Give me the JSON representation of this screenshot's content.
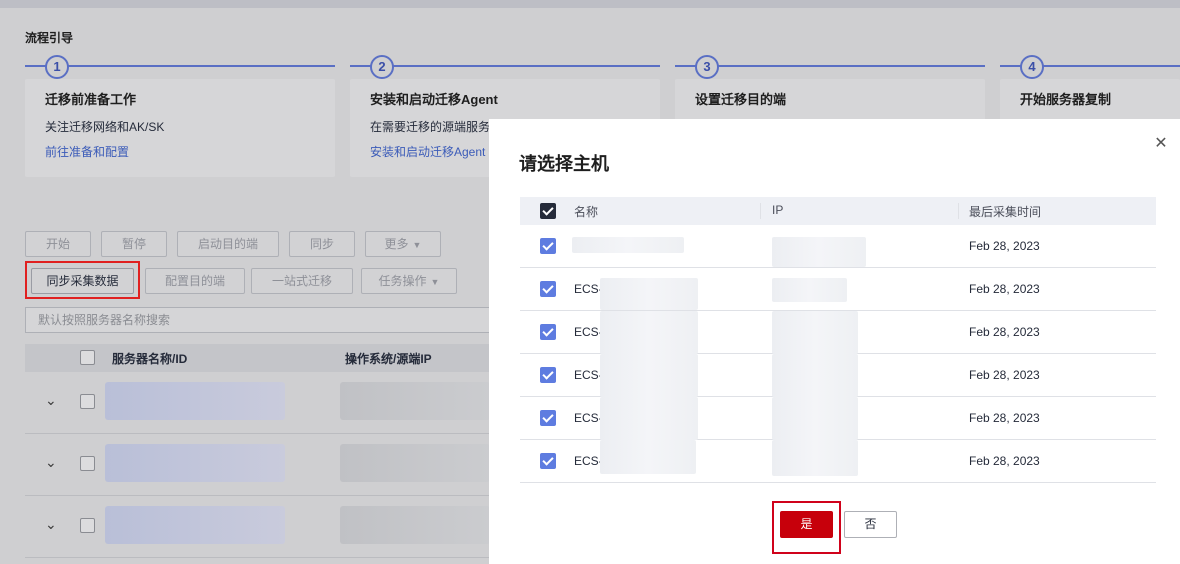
{
  "guide": {
    "title": "流程引导",
    "steps": [
      {
        "num": "1",
        "title": "迁移前准备工作",
        "desc": "关注迁移网络和AK/SK",
        "link": "前往准备和配置"
      },
      {
        "num": "2",
        "title": "安装和启动迁移Agent",
        "desc": "在需要迁移的源端服务器",
        "link": "安装和启动迁移Agent"
      },
      {
        "num": "3",
        "title": "设置迁移目的端",
        "desc": "",
        "link": ""
      },
      {
        "num": "4",
        "title": "开始服务器复制",
        "desc": "",
        "link": ""
      }
    ]
  },
  "toolbar": {
    "start": "开始",
    "pause": "暂停",
    "start_target": "启动目的端",
    "sync": "同步",
    "more": "更多",
    "sync_collect": "同步采集数据",
    "config_target": "配置目的端",
    "one_stop": "一站式迁移",
    "task_ops": "任务操作"
  },
  "search": {
    "placeholder": "默认按照服务器名称搜索"
  },
  "server_table": {
    "headers": [
      "服务器名称/ID",
      "操作系统/源端IP"
    ]
  },
  "dialog": {
    "title": "请选择主机",
    "headers": {
      "name": "名称",
      "ip": "IP",
      "time": "最后采集时间"
    },
    "rows": [
      {
        "name": "",
        "time": "Feb 28, 2023"
      },
      {
        "name": "ECS-",
        "time": "Feb 28, 2023"
      },
      {
        "name": "ECS-",
        "time": "Feb 28, 2023"
      },
      {
        "name": "ECS-",
        "time": "Feb 28, 2023"
      },
      {
        "name": "ECS-",
        "time": "Feb 28, 2023"
      },
      {
        "name": "ECS-",
        "time": "Feb 28, 2023"
      }
    ],
    "yes": "是",
    "no": "否"
  },
  "colors": {
    "primary_red": "#c7000b",
    "checkbox_blue": "#5e7ce0",
    "highlight": "#e02020"
  }
}
